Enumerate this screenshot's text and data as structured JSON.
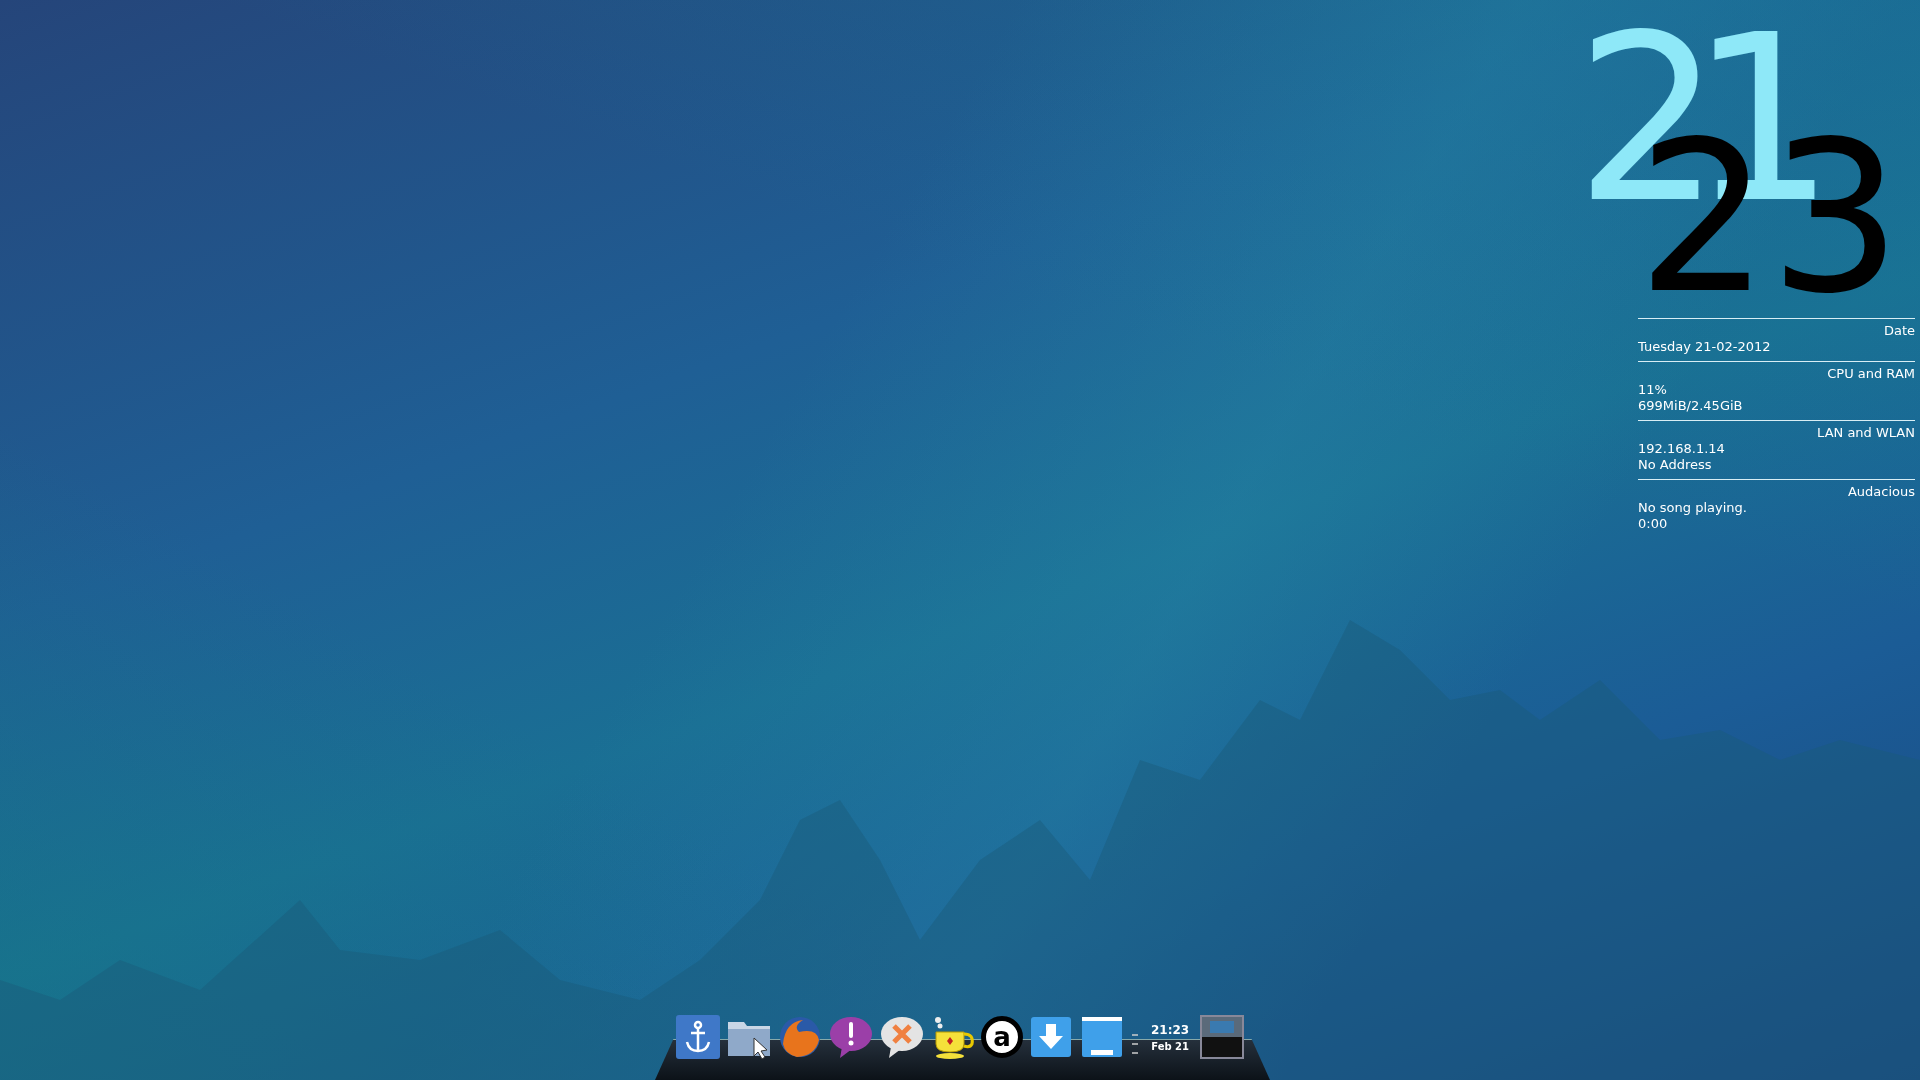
{
  "clock": {
    "hours": "21",
    "minutes": "23"
  },
  "sections": [
    {
      "title": "Date",
      "lines": [
        "Tuesday 21-02-2012"
      ]
    },
    {
      "title": "CPU and RAM",
      "lines": [
        "11%",
        "699MiB/2.45GiB"
      ]
    },
    {
      "title": "LAN and WLAN",
      "lines": [
        "192.168.1.14",
        "No Address"
      ]
    },
    {
      "title": "Audacious",
      "lines": [
        "No song playing.",
        "0:00"
      ]
    }
  ],
  "dock": {
    "launchers": [
      {
        "kind": "anchor"
      },
      {
        "kind": "folder"
      },
      {
        "kind": "globe"
      },
      {
        "kind": "alert-bubble"
      },
      {
        "kind": "cross-bubble"
      },
      {
        "kind": "teapot"
      },
      {
        "kind": "letter",
        "glyph": "a"
      },
      {
        "kind": "download"
      },
      {
        "kind": "window"
      }
    ],
    "time": "21:23",
    "date": "Feb 21"
  }
}
